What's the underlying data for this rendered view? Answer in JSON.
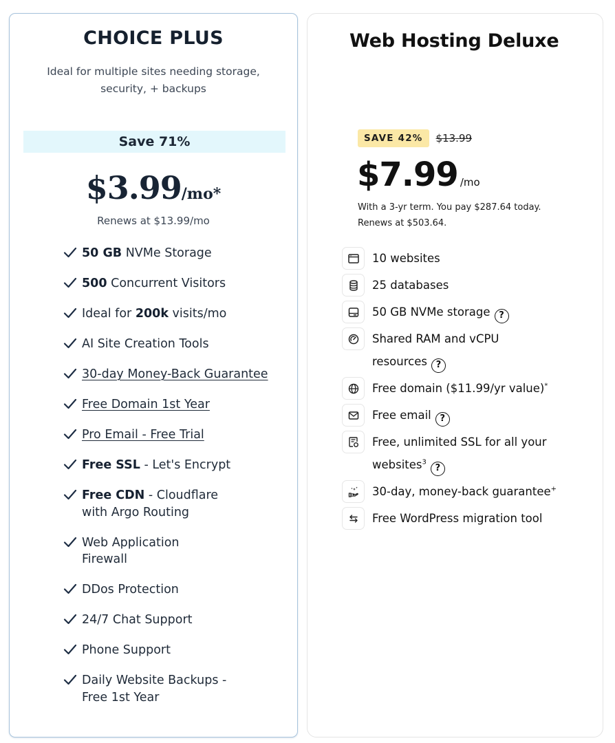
{
  "plans": {
    "choice_plus": {
      "title": "CHOICE PLUS",
      "subtitle": "Ideal for multiple sites needing storage, security, + backups",
      "save_banner": "Save 71%",
      "price": "$3.99",
      "price_unit": "/mo*",
      "renews": "Renews at $13.99/mo",
      "features": [
        {
          "bold": "50 GB",
          "text": " NVMe Storage"
        },
        {
          "bold": "500",
          "text": " Concurrent Visitors"
        },
        {
          "pre": "Ideal for ",
          "bold": "200k",
          "text": " visits/mo"
        },
        {
          "text": "AI Site Creation Tools"
        },
        {
          "link": "30-day Money-Back Guarantee"
        },
        {
          "link": "Free Domain 1st Year"
        },
        {
          "link": "Pro Email - Free Trial"
        },
        {
          "bold": "Free SSL",
          "text": " - Let's Encrypt"
        },
        {
          "bold": "Free CDN",
          "text": " - Cloudflare with Argo Routing"
        },
        {
          "text": "Web Application Firewall"
        },
        {
          "text": "DDos Protection"
        },
        {
          "text": "24/7 Chat Support"
        },
        {
          "text": "Phone Support"
        },
        {
          "text": "Daily Website Backups - Free 1st Year"
        }
      ],
      "check_icon": "checkmark-icon",
      "colors": {
        "border": "#a7c3dc",
        "save_bg": "#e3f7fc",
        "text": "#1b2533"
      }
    },
    "web_hosting_deluxe": {
      "title": "Web Hosting Deluxe",
      "badge": "SAVE 42%",
      "original_price": "$13.99",
      "price": "$7.99",
      "price_unit": "/mo",
      "term_line1": "With a 3-yr term. You pay $287.64 today.",
      "term_line2": "Renews at $503.64.",
      "features": [
        {
          "icon": "browser-window-icon",
          "text": "10 websites"
        },
        {
          "icon": "database-icon",
          "text": "25 databases"
        },
        {
          "icon": "hard-drive-icon",
          "text": "50 GB NVMe storage",
          "help": "?"
        },
        {
          "icon": "gauge-icon",
          "text": "Shared RAM and vCPU resources",
          "help": "?"
        },
        {
          "icon": "globe-icon",
          "text": "Free domain ($11.99/yr value)",
          "sup": "*"
        },
        {
          "icon": "mail-icon",
          "text": "Free email",
          "help": "?"
        },
        {
          "icon": "certificate-icon",
          "text": "Free, unlimited SSL for all your websites",
          "sup": "3",
          "help": "?"
        },
        {
          "icon": "hand-sparkle-icon",
          "text": "30-day, money-back guarantee",
          "sup": "+"
        },
        {
          "icon": "transfer-arrows-icon",
          "text": "Free WordPress migration tool"
        }
      ],
      "colors": {
        "badge_bg": "#fbe8a6",
        "border": "#e4e4e4",
        "text": "#111111"
      }
    }
  }
}
